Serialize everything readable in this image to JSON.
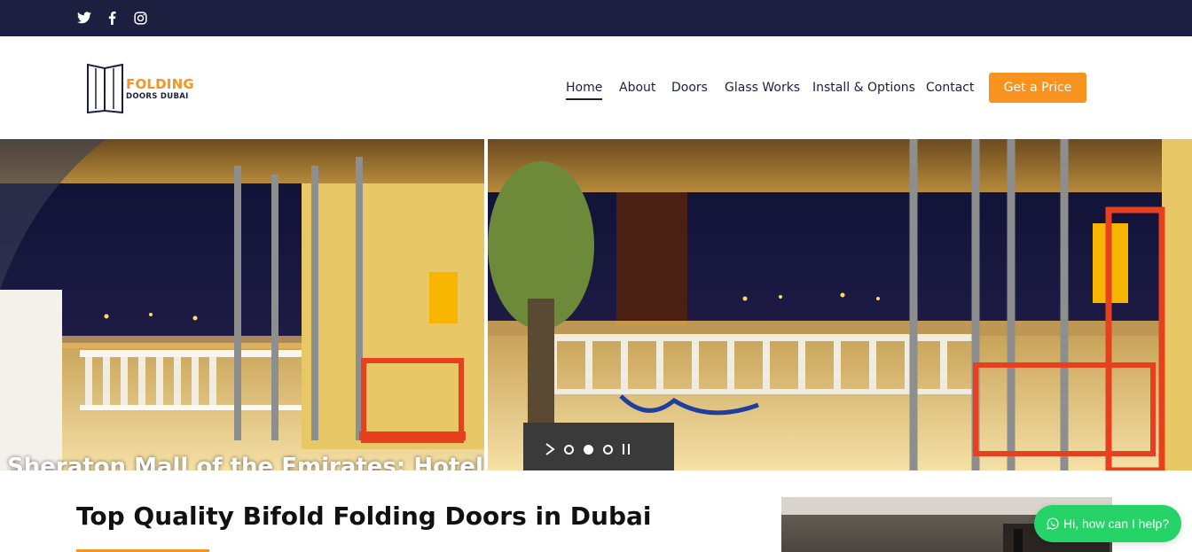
{
  "social": {
    "twitter_icon": "twitter-icon",
    "facebook_icon": "facebook-icon",
    "instagram_icon": "instagram-icon"
  },
  "header": {
    "logo": {
      "line1": "FOLDING",
      "line2": "DOORS DUBAI"
    },
    "nav": [
      {
        "label": "Home",
        "active": true
      },
      {
        "label": "About",
        "active": false
      },
      {
        "label": "Doors",
        "active": false
      },
      {
        "label": "Glass Works",
        "active": false
      },
      {
        "label": "Install & Options",
        "active": false
      },
      {
        "label": "Contact",
        "active": false
      }
    ],
    "cta_label": "Get a Price"
  },
  "hero": {
    "caption": "Sheraton Mall of the Emirates: Hotel",
    "slide_count": 3,
    "active_slide": 2,
    "controls": {
      "play_icon": "play-icon",
      "pause_icon": "pause-icon"
    }
  },
  "content": {
    "title": "Top Quality Bifold Folding Doors in Dubai"
  },
  "chat": {
    "label": "Hi, how can I help?",
    "icon": "whatsapp-icon"
  },
  "colors": {
    "topbar": "#1c1f3f",
    "accent": "#f7931e",
    "whatsapp": "#25d366"
  }
}
